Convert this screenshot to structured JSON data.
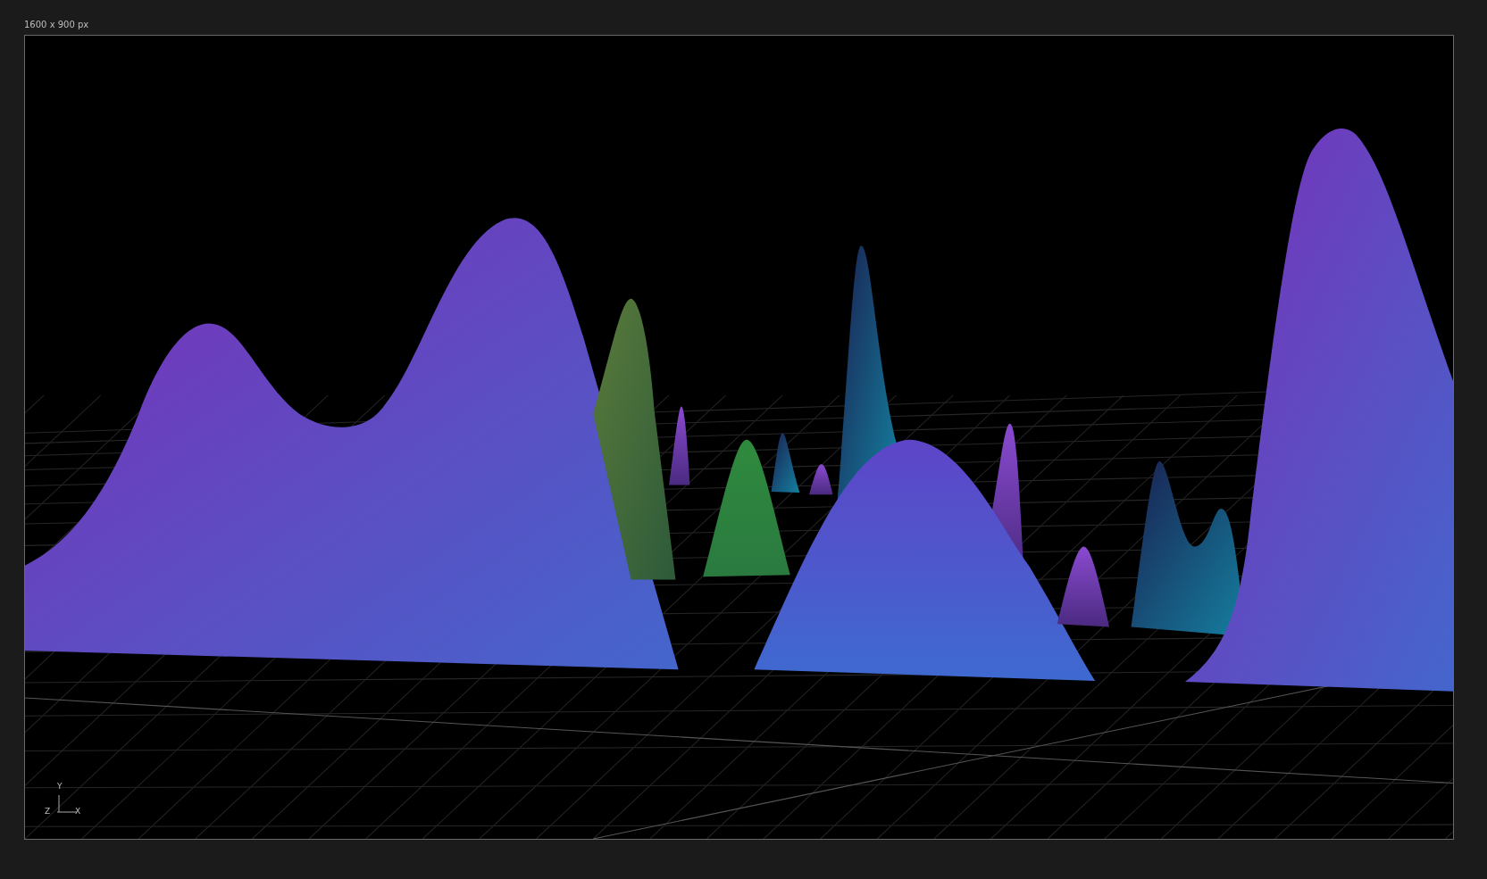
{
  "canvas": {
    "size_label": "1600 x 900 px"
  },
  "axis_gizmo": {
    "labels": [
      "Y",
      "Z",
      "X"
    ]
  }
}
